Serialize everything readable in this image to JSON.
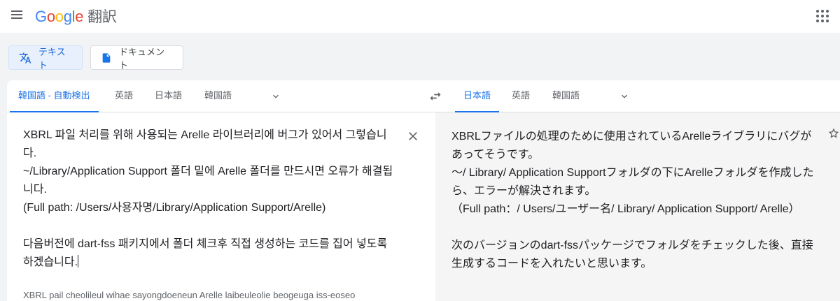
{
  "header": {
    "logo_parts": [
      "G",
      "o",
      "o",
      "g",
      "l",
      "e"
    ],
    "product": "翻訳",
    "icons": {
      "menu": "hamburger-menu-icon",
      "apps": "apps-grid-icon"
    }
  },
  "modes": {
    "text_label": "テキスト",
    "document_label": "ドキュメント"
  },
  "source": {
    "detect_label": "韓国語 - 自動検出",
    "lang_options": [
      "英語",
      "日本語",
      "韓国語"
    ],
    "lines": [
      "XBRL 파일 처리를 위해 사용되는 Arelle 라이브러리에 버그가 있어서 그렇습니다.",
      "~/Library/Application Support 폴더 밑에 Arelle 폴더를 만드시면 오류가 해결됩니다.",
      "(Full path: /Users/사용자명/Library/Application Support/Arelle)",
      "",
      "다음버전에 dart-fss 패키지에서 폴더 체크후 직접 생성하는 코드를 집어 넣도록 하겠습니다."
    ],
    "romanization": "XBRL pail cheolileul wihae sayongdoeneun Arelle laibeuleolie beogeuga iss-eoseo"
  },
  "target": {
    "lang_options": [
      "日本語",
      "英語",
      "韓国語"
    ],
    "lines": [
      "XBRLファイルの処理のために使用されているArelleライブラリにバグがあってそうです。",
      "〜/ Library/ Application Supportフォルダの下にArelleフォルダを作成したら、エラーが解決されます。",
      "（Full path：/ Users/ユーザー名/ Library/ Application Support/ Arelle）",
      "",
      "次のバージョンのdart-fssパッケージでフォルダをチェックした後、直接生成するコードを入れたいと思います。"
    ]
  },
  "colors": {
    "accent": "#1a73e8",
    "background": "#f1f3f4",
    "target_bg": "#f5f5f5"
  }
}
